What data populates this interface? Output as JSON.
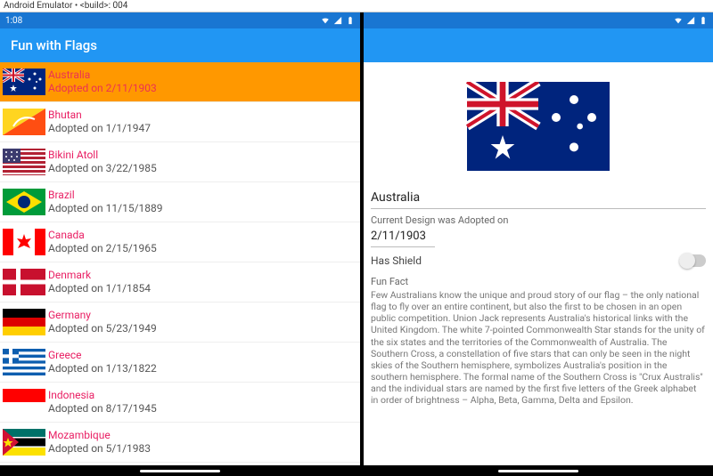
{
  "window_title": "Android Emulator • <build>: 004",
  "status": {
    "time": "1:08"
  },
  "app": {
    "title": "Fun with Flags"
  },
  "list": [
    {
      "name": "Australia",
      "adopted_label": "Adopted on 2/11/1903",
      "selected": true,
      "flag": "australia"
    },
    {
      "name": "Bhutan",
      "adopted_label": "Adopted on 1/1/1947",
      "selected": false,
      "flag": "bhutan"
    },
    {
      "name": "Bikini Atoll",
      "adopted_label": "Adopted on 3/22/1985",
      "selected": false,
      "flag": "bikini"
    },
    {
      "name": "Brazil",
      "adopted_label": "Adopted on 11/15/1889",
      "selected": false,
      "flag": "brazil"
    },
    {
      "name": "Canada",
      "adopted_label": "Adopted on 2/15/1965",
      "selected": false,
      "flag": "canada"
    },
    {
      "name": "Denmark",
      "adopted_label": "Adopted on 1/1/1854",
      "selected": false,
      "flag": "denmark"
    },
    {
      "name": "Germany",
      "adopted_label": "Adopted on 5/23/1949",
      "selected": false,
      "flag": "germany"
    },
    {
      "name": "Greece",
      "adopted_label": "Adopted on 1/13/1822",
      "selected": false,
      "flag": "greece"
    },
    {
      "name": "Indonesia",
      "adopted_label": "Adopted on 8/17/1945",
      "selected": false,
      "flag": "indonesia"
    },
    {
      "name": "Mozambique",
      "adopted_label": "Adopted on 5/1/1983",
      "selected": false,
      "flag": "mozambique"
    }
  ],
  "detail": {
    "name": "Australia",
    "adopted_label": "Current Design was Adopted on",
    "adopted_value": "2/11/1903",
    "shield_label": "Has Shield",
    "shield_on": false,
    "funfact_label": "Fun Fact",
    "funfact_text": "Few Australians know the unique and proud story of our flag – the only national flag to fly over an entire continent, but also the first to be chosen in an open public competition. Union Jack represents Australia's historical links with the United Kingdom. The white 7-pointed Commonwealth Star stands for the unity of the six states and the territories of the Commonwealth of Australia. The Southern Cross, a constellation of five stars that can only be seen in the night skies of the Southern hemisphere, symbolizes Australia's position in the southern hemisphere. The formal name of the Southern Cross is \"Crux Australis\" and the individual stars are named by the first five letters of the Greek alphabet in order of brightness – Alpha, Beta, Gamma, Delta and Epsilon."
  }
}
